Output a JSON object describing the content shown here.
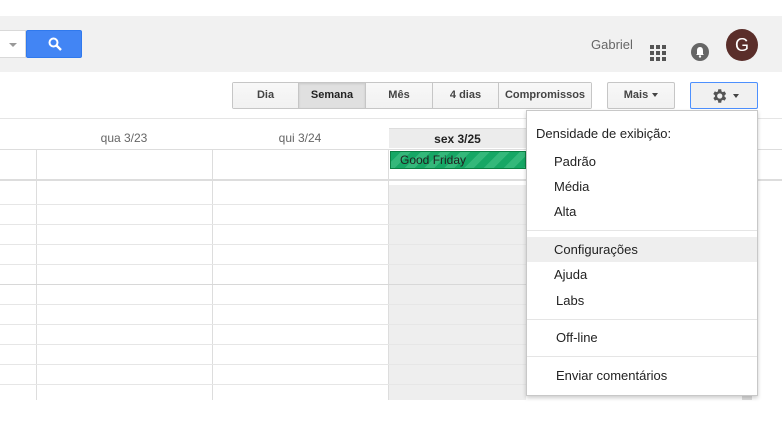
{
  "header": {
    "user_name": "Gabriel",
    "avatar_initial": "G",
    "brand_color": "#4285f4"
  },
  "toolbar": {
    "views": [
      {
        "label": "Dia",
        "active": false
      },
      {
        "label": "Semana",
        "active": true
      },
      {
        "label": "Mês",
        "active": false
      },
      {
        "label": "4 dias",
        "active": false
      },
      {
        "label": "Compromissos",
        "active": false
      }
    ],
    "more_label": "Mais"
  },
  "calendar": {
    "days": [
      {
        "label": "qua 3/23",
        "today": false
      },
      {
        "label": "qui 3/24",
        "today": false
      },
      {
        "label": "sex 3/25",
        "today": true
      }
    ],
    "allday_event": {
      "title": "Good Friday",
      "color": "#16a765"
    }
  },
  "settings_menu": {
    "header": "Densidade de exibição:",
    "density_options": [
      "Padrão",
      "Média",
      "Alta"
    ],
    "items": [
      "Configurações",
      "Ajuda",
      "Labs"
    ],
    "offline": "Off-line",
    "feedback": "Enviar comentários",
    "highlighted": "Configurações"
  }
}
